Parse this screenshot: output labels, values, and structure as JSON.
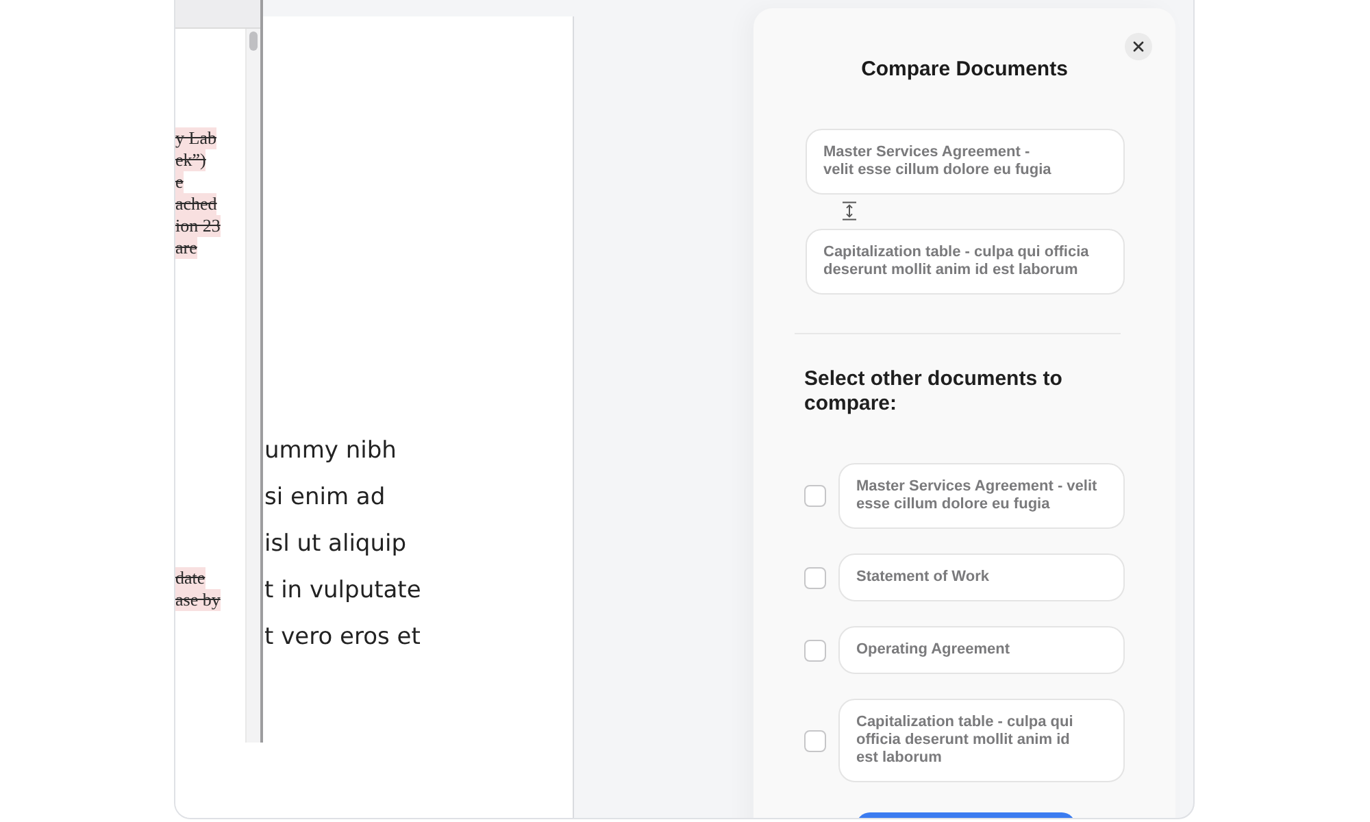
{
  "side_panel": {
    "blocks": [
      {
        "lines": [
          "y Lab",
          "ek”)",
          "e",
          "ached",
          "ion 23",
          "are"
        ]
      },
      {
        "lines": [
          "date",
          "ase by"
        ]
      }
    ]
  },
  "document": {
    "lines": [
      "ummy nibh",
      "si enim ad",
      "isl ut aliquip",
      "t in vulputate",
      "t vero eros et"
    ]
  },
  "compare_dialog": {
    "title": "Compare Documents",
    "selected_documents": [
      {
        "lines": [
          "Master Services Agreement -",
          "velit esse cillum dolore eu fugia"
        ]
      },
      {
        "lines": [
          "Capitalization table - culpa qui officia",
          "deserunt mollit anim id est laborum"
        ]
      }
    ],
    "other_heading": "Select other documents to compare:",
    "other_documents": [
      {
        "lines": [
          "Master Services Agreement - velit",
          "esse cillum dolore eu fugia"
        ],
        "checked": false
      },
      {
        "lines": [
          "Statement of Work"
        ],
        "checked": false
      },
      {
        "lines": [
          "Operating Agreement"
        ],
        "checked": false
      },
      {
        "lines": [
          "Capitalization table - culpa qui",
          "officia deserunt mollit anim id",
          "est laborum"
        ],
        "checked": false
      }
    ]
  }
}
